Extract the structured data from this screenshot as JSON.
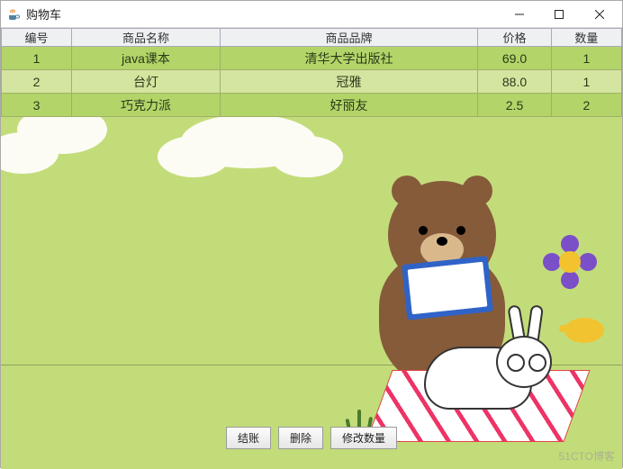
{
  "window": {
    "title": "购物车",
    "controls": {
      "minimize": "–",
      "maximize": "□",
      "close": "×"
    }
  },
  "table": {
    "headers": [
      "编号",
      "商品名称",
      "商品品牌",
      "价格",
      "数量"
    ],
    "rows": [
      {
        "id": "1",
        "name": "java课本",
        "brand": "清华大学出版社",
        "price": "69.0",
        "qty": "1"
      },
      {
        "id": "2",
        "name": "台灯",
        "brand": "冠雅",
        "price": "88.0",
        "qty": "1"
      },
      {
        "id": "3",
        "name": "巧克力派",
        "brand": "好丽友",
        "price": "2.5",
        "qty": "2"
      }
    ]
  },
  "buttons": {
    "checkout": "结账",
    "delete": "删除",
    "modify_qty": "修改数量"
  },
  "watermark": "51CTO博客"
}
